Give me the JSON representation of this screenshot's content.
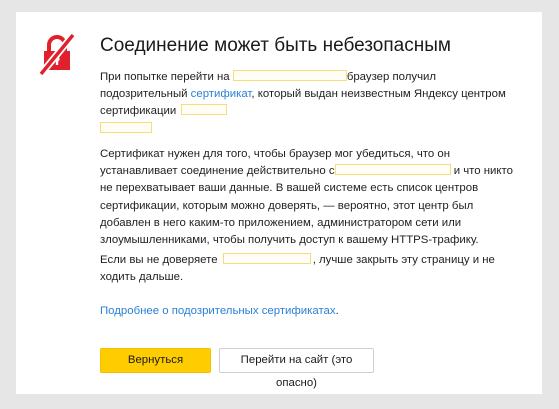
{
  "page": {
    "title": "Соединение может быть небезопасным",
    "accent_color": "#ffcc00",
    "danger_color": "#e0202c",
    "link_color": "#2a7fd6",
    "icon": "lock-crossed-icon"
  },
  "paragraph1": {
    "t1": "При попытке перейти на ",
    "t2": "браузер получил подозрительный ",
    "link": "сертификат",
    "t3": ", который выдан неизвестным Яндексу центром сертификации "
  },
  "paragraph2": {
    "t1": "Сертификат нужен для того, чтобы браузер мог убедиться, что он устанавливает соединение действительно с",
    "t2": " и что никто не перехватывает ваши данные. В вашей системе есть список центров сертификации, которым можно доверять, — вероятно, этот центр был добавлен в него каким-то приложением, администратором сети или злоумышленниками, чтобы получить доступ к вашему HTTPS-трафику."
  },
  "paragraph3": {
    "t1": "Если вы не доверяете ",
    "t2": ", лучше закрыть эту страницу и не ходить дальше."
  },
  "learn_more": {
    "link": "Подробнее о подозрительных сертификатах",
    "dot": "."
  },
  "buttons": {
    "back": "Вернуться",
    "proceed": "Перейти на сайт (это опасно)"
  }
}
